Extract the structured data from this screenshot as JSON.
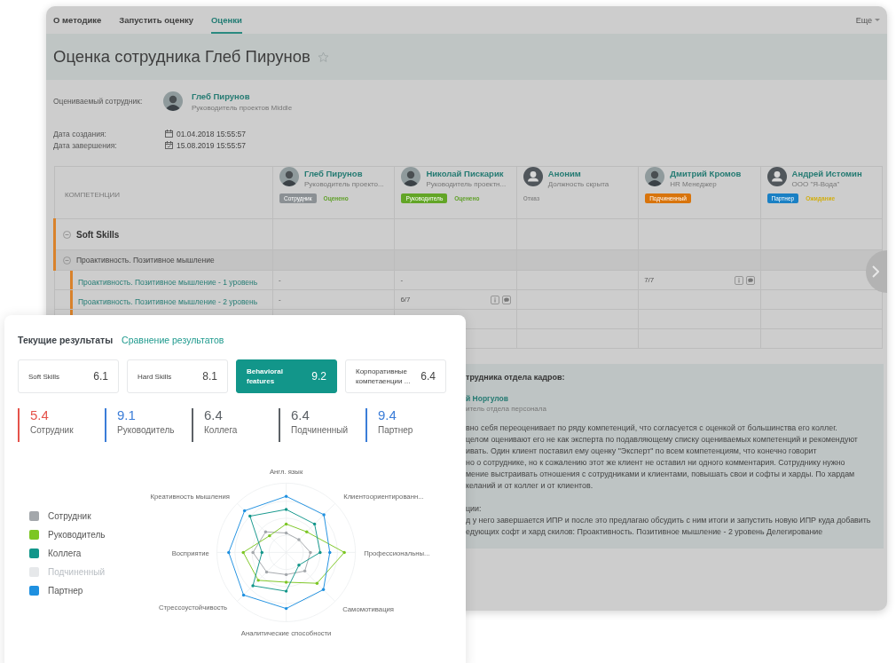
{
  "tabs": [
    {
      "label": "О методике",
      "selected": false
    },
    {
      "label": "Запустить оценку",
      "selected": false
    },
    {
      "label": "Оценки",
      "selected": true
    }
  ],
  "more_menu": "Еще",
  "title": "Оценка сотрудника Глеб Пирунов",
  "favorite": false,
  "employee": {
    "label": "Оцениваемый сотрудник:",
    "kind": "photo",
    "name": "Глеб Пирунов",
    "role": "Руководитель проектов Middle"
  },
  "dates": [
    {
      "label": "Дата создания:",
      "value": "01.04.2018 15:55:57",
      "kind": "created"
    },
    {
      "label": "Дата завершения:",
      "value": "15.08.2019 15:55:57",
      "kind": "finished"
    }
  ],
  "table": {
    "competence_header": "КОМПЕТЕНЦИИ",
    "participants": [
      {
        "name": "Глеб Пирунов",
        "role": "Руководитель проекто...",
        "kind": "photo",
        "badge": {
          "label": "Сотрудник",
          "color": "#8b9094"
        },
        "status": {
          "label": "Оценено",
          "color": "#5fa028"
        }
      },
      {
        "name": "Николай Пискарик",
        "role": "Руководитель проектн...",
        "kind": "photo",
        "badge": {
          "label": "Руководитель",
          "color": "#62a526"
        },
        "status": {
          "label": "Оценено",
          "color": "#5fa028"
        }
      },
      {
        "name": "Аноним",
        "role": "Должность скрыта",
        "kind": "anonymous",
        "status": {
          "label": "Отказ",
          "color": "#8a8a8a"
        }
      },
      {
        "name": "Дмитрий Кромов",
        "role": "HR Менеджер",
        "kind": "photo",
        "badge": {
          "label": "Подчиненный",
          "color": "#d8740c"
        }
      },
      {
        "name": "Андрей Истомин",
        "role": "ООО \"Я-Вода\"",
        "kind": "anonymous",
        "badge": {
          "label": "Партнер",
          "color": "#1a80c4"
        },
        "status": {
          "label": "Ожидание",
          "color": "#d1ae12"
        }
      }
    ],
    "groups": [
      {
        "label": "Soft Skills",
        "expanded": true,
        "children": [
          {
            "label": "Проактивность. Позитивное мышление",
            "expanded": true,
            "children": [
              {
                "label": "Проактивность. Позитивное мышление - 1 уровень",
                "cells": [
                  {
                    "value": "-"
                  },
                  {
                    "value": "-"
                  },
                  null,
                  {
                    "value": "7/7",
                    "actions": true
                  },
                  null
                ]
              },
              {
                "label": "Проактивность. Позитивное мышление - 2 уровень",
                "cells": [
                  {
                    "value": "-"
                  },
                  {
                    "value": "6/7",
                    "actions": true
                  },
                  null,
                  null,
                  null
                ]
              }
            ]
          }
        ]
      }
    ]
  },
  "comment": {
    "heading": "трудника отдела кадров:",
    "author": "й Норгулов",
    "author_role": "итель отдела персонала",
    "lines": [
      "вно себя переоценивает по ряду компетенций, что согласуется с оценкой от большинства его коллег.",
      "целом оценивают его не как эксперта по подавляющему списку оцениваемых компетенций и рекомендуют",
      "ивать. Один клиент поставил ему оценку \"Эксперт\" по всем компетенциям, что конечно говорит",
      "но о сотруднике, но к сожалению этот же клиент не оставил ни одного комментария. Сотруднику нужно",
      "мение выстраивать отношения с сотрудниками и клиентами, повышать свои и софты и харды. По хардам",
      "келаний и от коллег и от клиентов."
    ],
    "subheading": "ции:",
    "lines2": [
      "д у него завершается ИПР и после это предлагаю обсудить с ним итоги и запустить новую ИПР куда добавить",
      "едующих софт и хард скилов: Проактивность. Позитивное мышление - 2 уровень  Делегирование"
    ]
  },
  "results": {
    "tabs": [
      {
        "label": "Текущие результаты",
        "selected": true
      },
      {
        "label": "Сравнение результатов",
        "selected": false
      }
    ],
    "categories": [
      {
        "label": "Soft Skills",
        "score": "6.1",
        "selected": false
      },
      {
        "label": "Hard Skills",
        "score": "8.1",
        "selected": false
      },
      {
        "label": "Behavioral features",
        "score": "9.2",
        "selected": true
      },
      {
        "label": "Корпоративные компетаенции ...",
        "score": "6.4",
        "selected": false
      }
    ],
    "scores": [
      {
        "value": "5.4",
        "label": "Сотрудник",
        "color": "#e5534b"
      },
      {
        "value": "9.1",
        "label": "Руководитель",
        "color": "#3b7dd8"
      },
      {
        "value": "6.4",
        "label": "Коллега",
        "color": "#5c6166"
      },
      {
        "value": "6.4",
        "label": "Подчиненный",
        "color": "#5c6166"
      },
      {
        "value": "9.4",
        "label": "Партнер",
        "color": "#3b7dd8"
      }
    ],
    "legend": [
      {
        "label": "Сотрудник",
        "color": "#a3a7ab",
        "hidden": false
      },
      {
        "label": "Руководитель",
        "color": "#7cc623",
        "hidden": false
      },
      {
        "label": "Коллега",
        "color": "#12968a",
        "hidden": false
      },
      {
        "label": "Подчиненный",
        "color": "#e6e8ea",
        "hidden": true
      },
      {
        "label": "Партнер",
        "color": "#1e90e0",
        "hidden": false
      }
    ],
    "radar_axes": [
      "Англ. язык",
      "Креативность мышления",
      "Клиентоориентированн...",
      "Восприятие",
      "Профессиональны...",
      "Стрессоустойчивость",
      "Самомотивация",
      "Аналитические способности"
    ]
  }
}
